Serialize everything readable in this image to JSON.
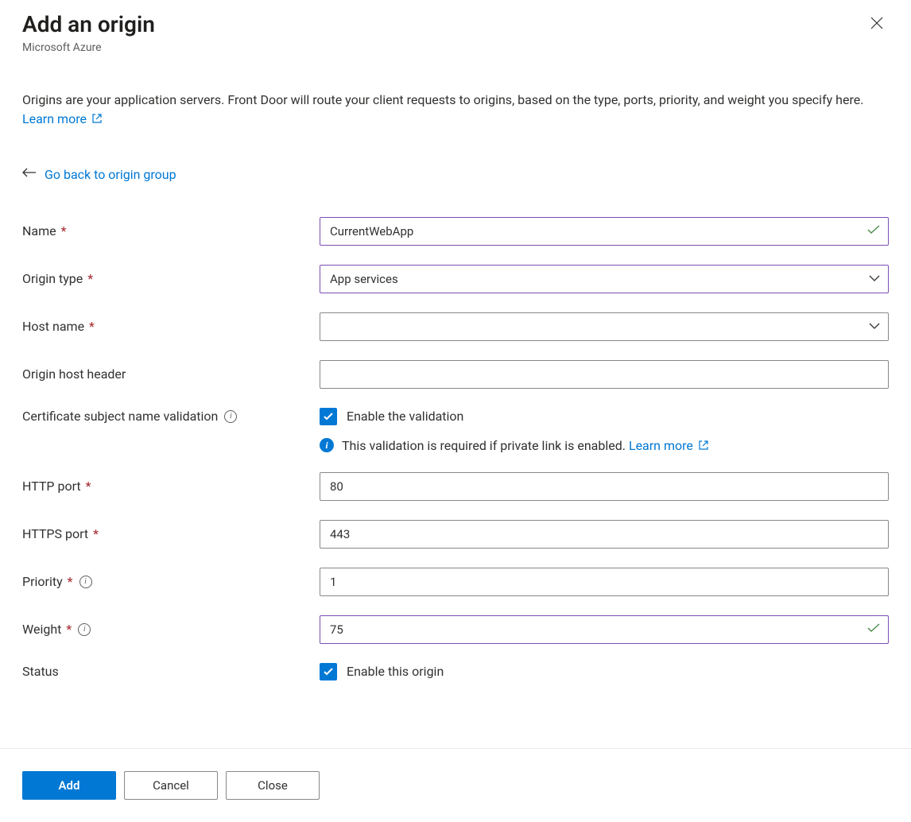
{
  "header": {
    "title": "Add an origin",
    "subtitle": "Microsoft Azure"
  },
  "description": {
    "text": "Origins are your application servers. Front Door will route your client requests to origins, based on the type, ports, priority, and weight you specify here. ",
    "learn_more": "Learn more"
  },
  "back_link": "Go back to origin group",
  "form": {
    "name": {
      "label": "Name",
      "value": "CurrentWebApp",
      "required": true,
      "valid": true
    },
    "origin_type": {
      "label": "Origin type",
      "value": "App services",
      "required": true,
      "valid": true
    },
    "host_name": {
      "label": "Host name",
      "value": "",
      "required": true
    },
    "origin_host_header": {
      "label": "Origin host header",
      "value": ""
    },
    "cert_validation": {
      "label": "Certificate subject name validation",
      "checkbox_label": "Enable the validation",
      "checked": true,
      "info_text": "This validation is required if private link is enabled. ",
      "info_link": "Learn more"
    },
    "http_port": {
      "label": "HTTP port",
      "value": "80",
      "required": true
    },
    "https_port": {
      "label": "HTTPS port",
      "value": "443",
      "required": true
    },
    "priority": {
      "label": "Priority",
      "value": "1",
      "required": true
    },
    "weight": {
      "label": "Weight",
      "value": "75",
      "required": true,
      "valid": true
    },
    "status": {
      "label": "Status",
      "checkbox_label": "Enable this origin",
      "checked": true
    }
  },
  "footer": {
    "add": "Add",
    "cancel": "Cancel",
    "close": "Close"
  }
}
